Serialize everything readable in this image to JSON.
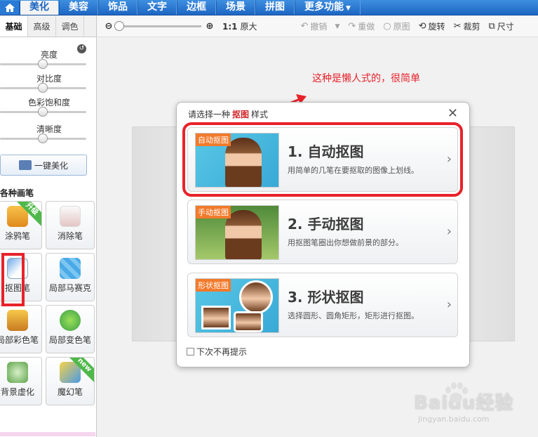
{
  "topnav": {
    "tabs": [
      {
        "label": "美化",
        "active": true
      },
      {
        "label": "美容"
      },
      {
        "label": "饰品"
      },
      {
        "label": "文字"
      },
      {
        "label": "边框"
      },
      {
        "label": "场景"
      },
      {
        "label": "拼图"
      },
      {
        "label": "更多功能"
      }
    ]
  },
  "sidebar": {
    "subtabs": [
      "基础",
      "高级",
      "调色"
    ],
    "sliders": [
      {
        "label": "亮度"
      },
      {
        "label": "对比度"
      },
      {
        "label": "色彩饱和度"
      },
      {
        "label": "清晰度"
      }
    ],
    "onekey_label": "一键美化",
    "section_title": "各种画笔",
    "tools": [
      {
        "label": "涂鸦笔",
        "badge": "升级"
      },
      {
        "label": "消除笔"
      },
      {
        "label": "抠图笔"
      },
      {
        "label": "局部马赛克"
      },
      {
        "label": "局部彩色笔"
      },
      {
        "label": "局部变色笔"
      },
      {
        "label": "背景虚化"
      },
      {
        "label": "魔幻笔",
        "badge": "new"
      }
    ]
  },
  "toolbar": {
    "ratio_label": "1:1",
    "original_size": "原大",
    "undo": "撤销",
    "redo": "重做",
    "original": "原图",
    "rotate": "旋转",
    "crop": "裁剪",
    "size": "尺寸"
  },
  "annotation": "这种是懒人式的，很简单",
  "dialog": {
    "title_prefix": "请选择一种",
    "title_highlight": "抠图",
    "title_suffix": "样式",
    "options": [
      {
        "tag": "自动抠图",
        "title": "1. 自动抠图",
        "desc": "用简单的几笔在要抠取的图像上划线。"
      },
      {
        "tag": "手动抠图",
        "title": "2. 手动抠图",
        "desc": "用抠图笔圈出你想做前景的部分。"
      },
      {
        "tag": "形状抠图",
        "title": "3. 形状抠图",
        "desc": "选择圆形、圆角矩形，矩形进行抠图。"
      }
    ],
    "checkbox_label": "下次不再提示"
  },
  "watermark": {
    "main": "Baidu经验",
    "sub": "jingyan.baidu.com"
  },
  "colors": {
    "accent": "#1d66c3",
    "highlight": "#e8222a",
    "orange_tag": "#f27a2b"
  }
}
